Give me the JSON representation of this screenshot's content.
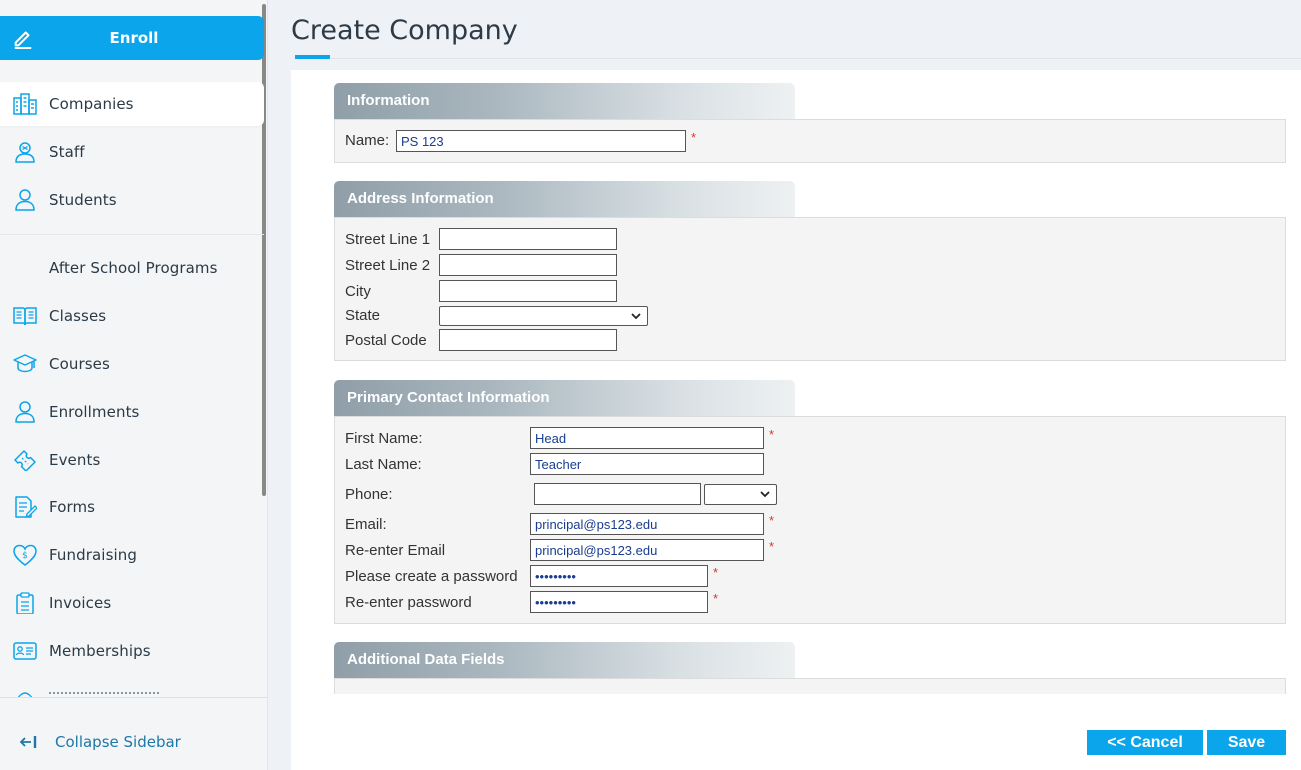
{
  "sidebar": {
    "enroll_label": "Enroll",
    "items": [
      {
        "label": "Companies",
        "icon": "building-icon"
      },
      {
        "label": "Staff",
        "icon": "staff-icon"
      },
      {
        "label": "Students",
        "icon": "person-icon"
      },
      {
        "label": "After School Programs",
        "icon": ""
      },
      {
        "label": "Classes",
        "icon": "book-icon"
      },
      {
        "label": "Courses",
        "icon": "graduation-cap-icon"
      },
      {
        "label": "Enrollments",
        "icon": "person-icon"
      },
      {
        "label": "Events",
        "icon": "ticket-icon"
      },
      {
        "label": "Forms",
        "icon": "form-icon"
      },
      {
        "label": "Fundraising",
        "icon": "heart-dollar-icon"
      },
      {
        "label": "Invoices",
        "icon": "clipboard-icon"
      },
      {
        "label": "Memberships",
        "icon": "id-card-icon"
      }
    ],
    "collapse_label": "Collapse Sidebar",
    "accent": "#0aa5ea"
  },
  "page": {
    "title": "Create Company"
  },
  "sections": {
    "information": {
      "title": "Information",
      "name_label": "Name:",
      "name_value": "PS 123"
    },
    "address": {
      "title": "Address Information",
      "street1_label": "Street Line 1",
      "street2_label": "Street Line 2",
      "city_label": "City",
      "state_label": "State",
      "postal_label": "Postal Code"
    },
    "contact": {
      "title": "Primary Contact Information",
      "first_label": "First Name:",
      "first_value": "Head",
      "last_label": "Last Name:",
      "last_value": "Teacher",
      "phone_label": "Phone:",
      "email_label": "Email:",
      "email_value": "principal@ps123.edu",
      "reemail_label": "Re-enter Email",
      "reemail_value": "principal@ps123.edu",
      "password_label": "Please create a password",
      "password_value": "•••••••••",
      "repassword_label": "Re-enter password",
      "repassword_value": "•••••••••"
    },
    "additional": {
      "title": "Additional Data Fields"
    }
  },
  "actions": {
    "cancel_label": "<< Cancel",
    "save_label": "Save"
  },
  "required_mark": "*"
}
